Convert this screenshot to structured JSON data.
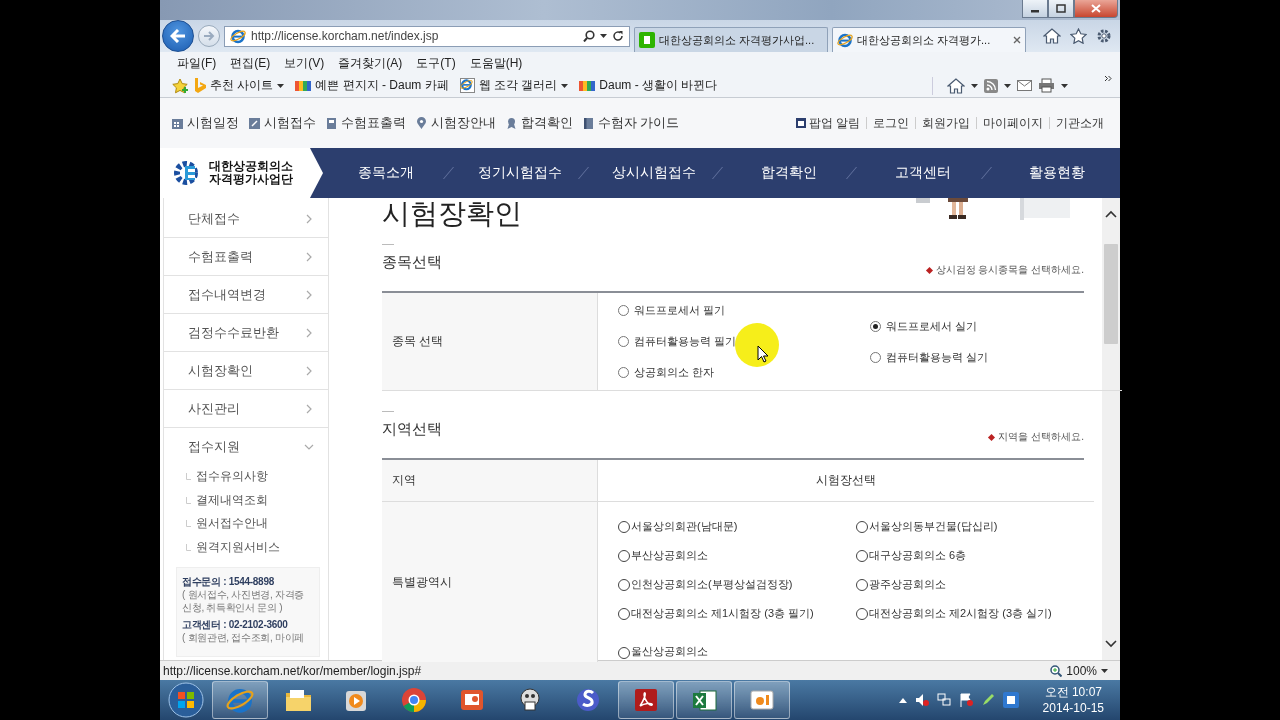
{
  "browser": {
    "address": "http://license.korcham.net/index.jsp",
    "tabs": [
      {
        "title": "대한상공회의소 자격평가사업...",
        "selected": false
      },
      {
        "title": "대한상공회의소 자격평가...",
        "selected": true
      }
    ],
    "menu": [
      "파일(F)",
      "편집(E)",
      "보기(V)",
      "즐겨찾기(A)",
      "도구(T)",
      "도움말(H)"
    ],
    "favorites": [
      {
        "label": "추천 사이트",
        "dropdown": true
      },
      {
        "label": "예쁜 편지지 - Daum 카페",
        "dropdown": false
      },
      {
        "label": "웹 조각 갤러리",
        "dropdown": true
      },
      {
        "label": "Daum - 생활이 바뀐다",
        "dropdown": false
      }
    ]
  },
  "site": {
    "quick_links": [
      "시험일정",
      "시험접수",
      "수험표출력",
      "시험장안내",
      "합격확인",
      "수험자 가이드"
    ],
    "account_links": [
      "팝업 알림",
      "로그인",
      "회원가입",
      "마이페이지",
      "기관소개"
    ],
    "logo": [
      "대한상공회의소",
      "자격평가사업단"
    ],
    "nav": [
      "종목소개",
      "정기시험접수",
      "상시시험접수",
      "합격확인",
      "고객센터",
      "활용현황"
    ]
  },
  "sidebar": {
    "items": [
      {
        "label": "단체접수",
        "expanded": false
      },
      {
        "label": "수험표출력",
        "expanded": false
      },
      {
        "label": "접수내역변경",
        "expanded": false
      },
      {
        "label": "검정수수료반환",
        "expanded": false
      },
      {
        "label": "시험장확인",
        "expanded": false
      },
      {
        "label": "사진관리",
        "expanded": false
      },
      {
        "label": "접수지원",
        "expanded": true,
        "children": [
          {
            "label": "접수유의사항"
          },
          {
            "label": "결제내역조회"
          },
          {
            "label": "원서접수안내"
          },
          {
            "label": "원격지원서비스"
          }
        ]
      }
    ],
    "contacts": [
      {
        "label": "접수문의 : 1544-8898",
        "note": "( 원서접수, 사진변경, 자격증 신청, 취득확인서 문의 )"
      },
      {
        "label": "고객센터 : 02-2102-3600",
        "note": "( 회원관련, 접수조회, 마이페"
      }
    ]
  },
  "page_title": "시험장확인",
  "exam_section": {
    "title": "종목선택",
    "note": "상시검정 응시종목을 선택하세요.",
    "row_label": "종목 선택",
    "columns": [
      [
        {
          "label": "워드프로세서 필기",
          "selected": false
        },
        {
          "label": "컴퓨터활용능력 필기",
          "selected": false
        },
        {
          "label": "상공회의소 한자",
          "selected": false
        }
      ],
      [
        {
          "label": "워드프로세서 실기",
          "selected": true
        },
        {
          "label": "컴퓨터활용능력 실기",
          "selected": false
        }
      ]
    ]
  },
  "region_section": {
    "title": "지역선택",
    "note": "지역을 선택하세요.",
    "columns": [
      "지역",
      "시험장선택"
    ],
    "rows": [
      {
        "region": "특별광역시",
        "sites": [
          {
            "label": "서울상의회관(남대문)",
            "selected": false
          },
          {
            "label": "서울상의동부건물(답십리)",
            "selected": false
          },
          {
            "label": "부산상공회의소",
            "selected": false
          },
          {
            "label": "대구상공회의소 6층",
            "selected": false
          },
          {
            "label": "인천상공회의소(부평상설검정장)",
            "selected": false
          },
          {
            "label": "광주상공회의소",
            "selected": false
          },
          {
            "label": "대전상공회의소 제1시험장 (3층 필기)",
            "selected": false
          },
          {
            "label": "대전상공회의소 제2시험장 (3층 실기)",
            "selected": false
          },
          {
            "label": "울산상공회의소",
            "selected": false
          }
        ]
      }
    ]
  },
  "status_bar": {
    "url": "http://license.korcham.net/kor/member/login.jsp#",
    "zoom": "100%"
  },
  "taskbar": {
    "apps": [
      {
        "active": true
      },
      {
        "active": false
      },
      {
        "active": false
      },
      {
        "active": false
      },
      {
        "active": false
      },
      {
        "active": false
      },
      {
        "active": false
      },
      {
        "active": true
      },
      {
        "active": true
      },
      {
        "active": true
      }
    ],
    "time": "오전 10:07",
    "date": "2014-10-15"
  }
}
